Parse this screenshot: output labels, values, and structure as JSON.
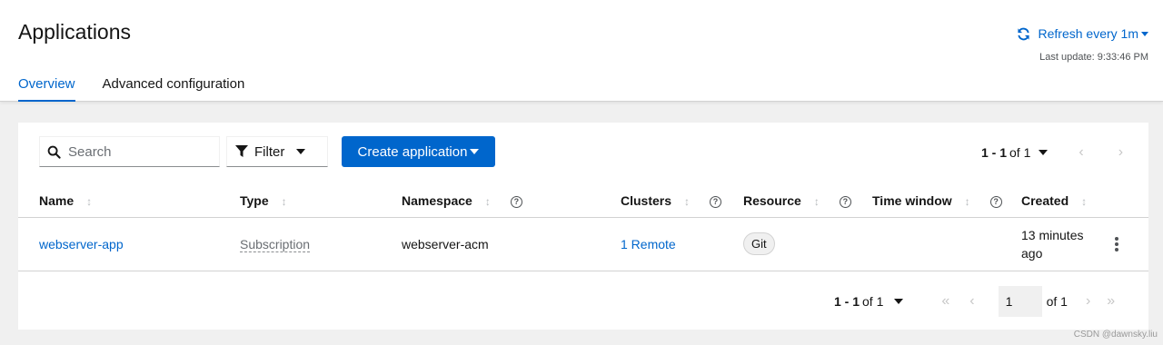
{
  "header": {
    "title": "Applications",
    "refresh_label": "Refresh every 1m",
    "last_update": "Last update: 9:33:46 PM",
    "tabs": [
      {
        "label": "Overview",
        "active": true
      },
      {
        "label": "Advanced configuration",
        "active": false
      }
    ]
  },
  "toolbar": {
    "search_placeholder": "Search",
    "filter_label": "Filter",
    "create_label": "Create application",
    "pagination_range": "1 - 1",
    "pagination_of": "of 1"
  },
  "table": {
    "columns": [
      "Name",
      "Type",
      "Namespace",
      "Clusters",
      "Resource",
      "Time window",
      "Created"
    ],
    "rows": [
      {
        "name": "webserver-app",
        "type": "Subscription",
        "namespace": "webserver-acm",
        "clusters": "1 Remote",
        "resource": "Git",
        "time_window": "",
        "created_line1": "13 minutes",
        "created_line2": "ago"
      }
    ]
  },
  "footer": {
    "pagination_range": "1 - 1",
    "pagination_of": "of 1",
    "page_value": "1",
    "page_total": "of 1"
  },
  "watermark": "CSDN @dawnsky.liu",
  "colors": {
    "accent": "#0066cc",
    "background": "#f0f0f0"
  }
}
